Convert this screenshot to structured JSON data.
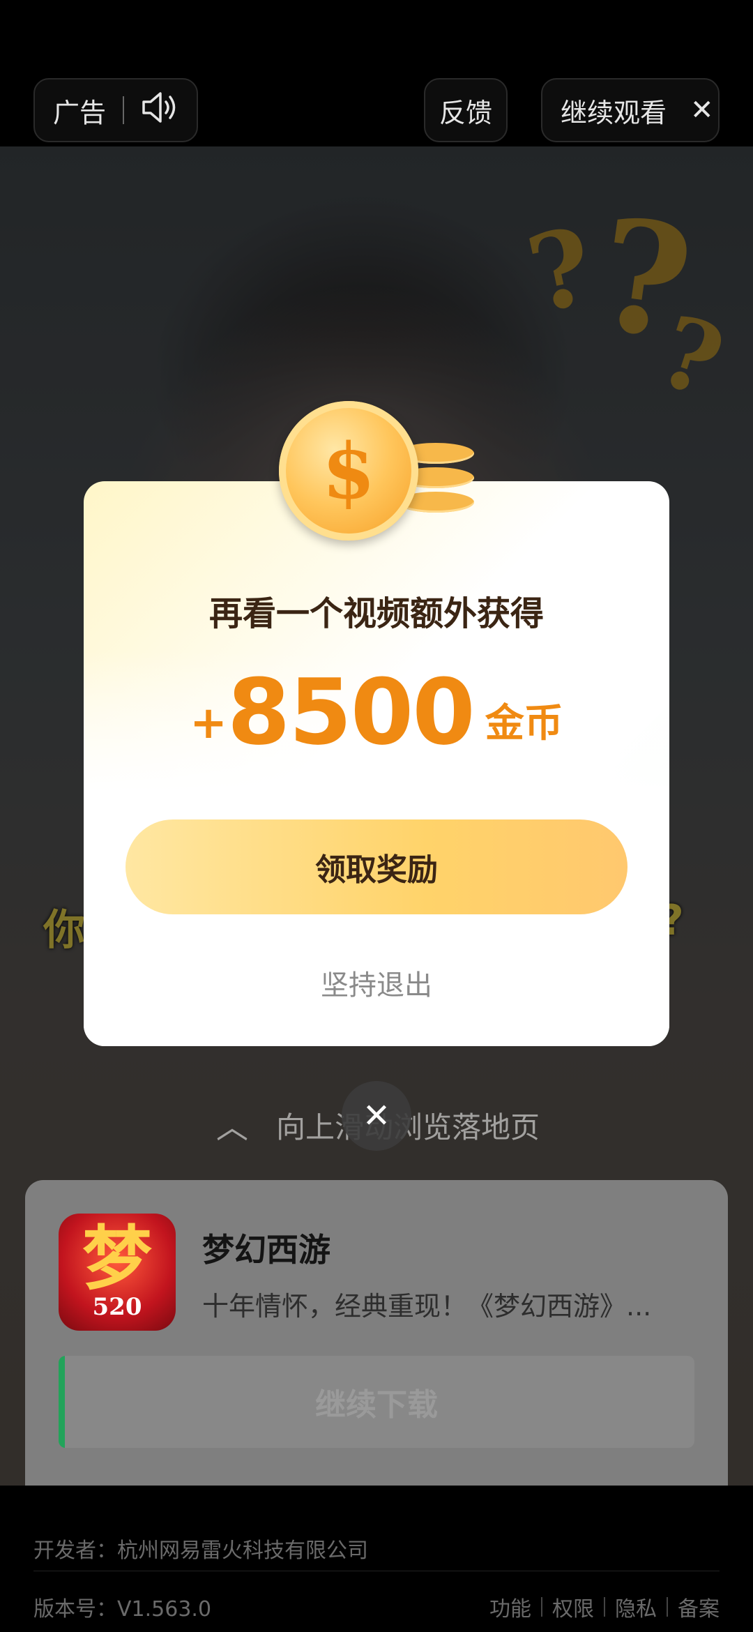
{
  "top_bar": {
    "ad_label": "广告",
    "feedback_label": "反馈",
    "continue_label": "继续观看",
    "close_icon": "close-icon",
    "sound_icon": "speaker-icon"
  },
  "video": {
    "subtitle_left": "你",
    "subtitle_right": "?",
    "swipe_hint": "向上滑动浏览落地页"
  },
  "reward_dialog": {
    "title": "再看一个视频额外获得",
    "plus": "+",
    "amount": "8500",
    "unit": "金币",
    "claim_label": "领取奖励",
    "quit_label": "坚持退出",
    "coin_icon": "coin-icon"
  },
  "app_card": {
    "name": "梦幻西游",
    "description": "十年情怀，经典重现！《梦幻西游》...",
    "icon_char": "梦",
    "icon_number": "520",
    "download_label": "继续下载",
    "download_progress": 0.01
  },
  "footer": {
    "developer": "开发者：杭州网易雷火科技有限公司",
    "version": "版本号：V1.563.0",
    "links": [
      "功能",
      "权限",
      "隐私",
      "备案"
    ]
  },
  "colors": {
    "accent_orange": "#f08a12",
    "button_yellow": "#ffd36a",
    "progress_green": "#22a35a"
  }
}
